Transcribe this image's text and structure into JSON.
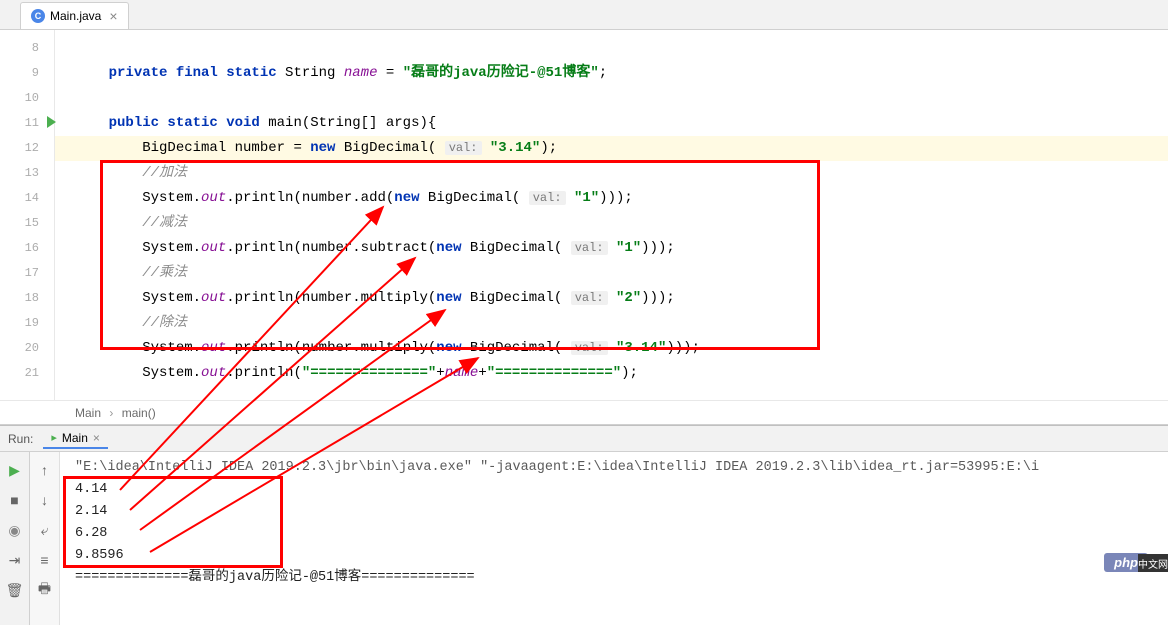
{
  "tab": {
    "title": "Main.java",
    "icon_letter": "C"
  },
  "code": {
    "lines": [
      8,
      9,
      10,
      11,
      12,
      13,
      14,
      15,
      16,
      17,
      18,
      19,
      20,
      21
    ],
    "decl_kw": "private final static",
    "decl_type": "String",
    "decl_name": "name",
    "decl_eq": " = ",
    "name_value": "\"磊哥的java历险记-@51博客\"",
    "main_sig_kw": "public static void",
    "main_sig_rest": " main(String[] args){",
    "bigdec_decl": "BigDecimal number = ",
    "new_kw": "new",
    "bigdec_type": " BigDecimal( ",
    "val_hint": "val:",
    "bigdec_val": "\"3.14\"",
    "close_paren": ");",
    "comment_add": "//加法",
    "comment_sub": "//减法",
    "comment_mul": "//乘法",
    "comment_div": "//除法",
    "sys_out": "System.",
    "out_field": "out",
    "println": ".println(number",
    "println2": ".println(",
    "add_call": ".add(",
    "sub_call": ".subtract(",
    "mul_call": ".multiply(",
    "val1": "\"1\"",
    "val2": "\"2\"",
    "val314": "\"3.14\"",
    "triple_close": ")));",
    "sep_line_pre": "System.",
    "sep_str1": "\"==============\"",
    "sep_plus": "+",
    "sep_name": "name",
    "sep_str2": "\"==============\"",
    "sep_end": ");"
  },
  "breadcrumb": {
    "class": "Main",
    "method": "main()"
  },
  "run": {
    "label": "Run:",
    "tab_name": "Main",
    "cmd": "\"E:\\idea\\IntelliJ IDEA 2019.2.3\\jbr\\bin\\java.exe\" \"-javaagent:E:\\idea\\IntelliJ IDEA 2019.2.3\\lib\\idea_rt.jar=53995:E:\\i",
    "out1": "4.14",
    "out2": "2.14",
    "out3": "6.28",
    "out4": "9.8596",
    "sep": "==============磊哥的java历险记-@51博客=============="
  },
  "badge": {
    "php": "php",
    "cn": "中文网"
  }
}
